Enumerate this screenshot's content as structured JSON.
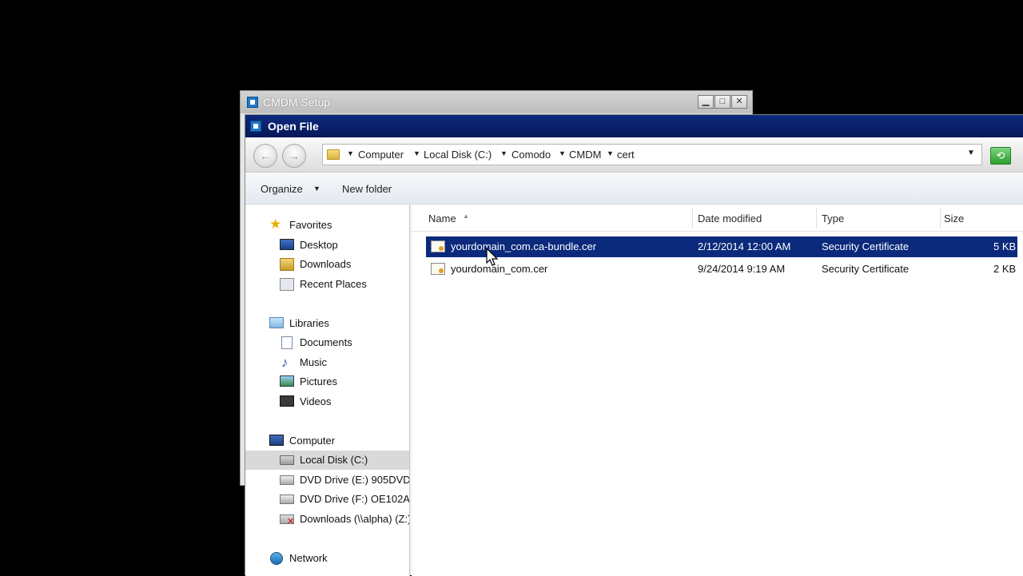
{
  "setup_window": {
    "title": "CMDM Setup"
  },
  "dialog": {
    "title": "Open File",
    "breadcrumb": [
      "Computer",
      "Local Disk (C:)",
      "Comodo",
      "CMDM",
      "cert"
    ],
    "toolbar": {
      "organize_label": "Organize",
      "new_folder_label": "New folder"
    }
  },
  "nav_pane": {
    "favorites": {
      "label": "Favorites",
      "items": [
        "Desktop",
        "Downloads",
        "Recent Places"
      ]
    },
    "libraries": {
      "label": "Libraries",
      "items": [
        "Documents",
        "Music",
        "Pictures",
        "Videos"
      ]
    },
    "computer": {
      "label": "Computer",
      "items": [
        "Local Disk (C:)",
        "DVD Drive (E:) 905DVD",
        "DVD Drive (F:) OE102A",
        "Downloads (\\\\alpha) (Z:)"
      ]
    },
    "network": {
      "label": "Network"
    }
  },
  "file_list": {
    "columns": [
      "Name",
      "Date modified",
      "Type",
      "Size"
    ],
    "rows": [
      {
        "name": "yourdomain_com.ca-bundle.cer",
        "date": "2/12/2014 12:00 AM",
        "type": "Security Certificate",
        "size": "5 KB",
        "selected": true
      },
      {
        "name": "yourdomain_com.cer",
        "date": "9/24/2014 9:19 AM",
        "type": "Security Certificate",
        "size": "2 KB",
        "selected": false
      }
    ]
  },
  "icons": {
    "app": "app-icon",
    "back": "back-arrow-icon",
    "forward": "forward-arrow-icon",
    "refresh": "refresh-icon",
    "certificate": "certificate-icon"
  },
  "colors": {
    "selection": "#0b2a7c",
    "title_bar": "#0b2a7c"
  }
}
